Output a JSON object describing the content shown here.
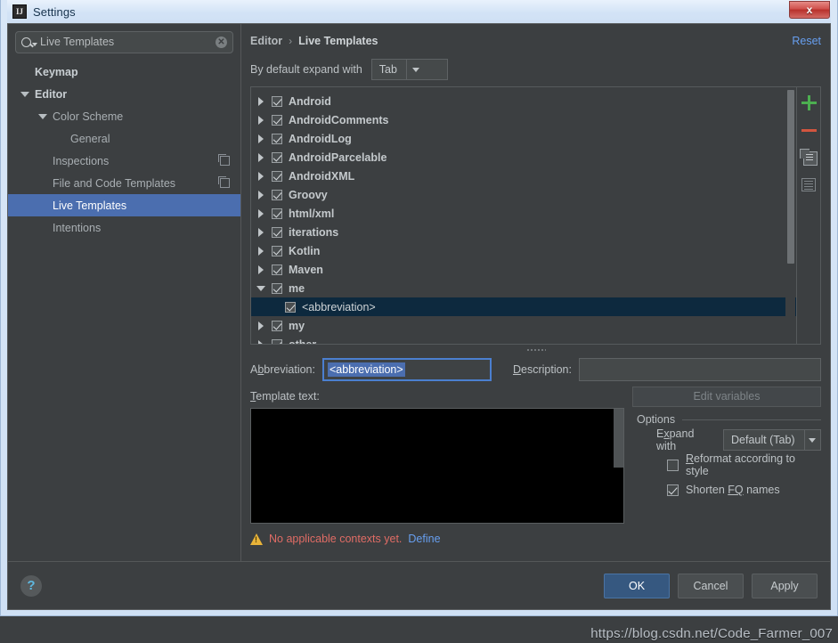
{
  "window": {
    "title": "Settings",
    "app_icon": "IJ",
    "close_label": "x"
  },
  "watermark": "https://blog.csdn.net/Code_Farmer_007",
  "search": {
    "value": "Live Templates",
    "icon": "search-icon",
    "clear_icon": "clear-icon",
    "clear_label": "✕"
  },
  "sidebar": {
    "items": [
      {
        "label": "Keymap",
        "indent": 0,
        "arrow": "none",
        "bold": true,
        "selected": false,
        "badge": false
      },
      {
        "label": "Editor",
        "indent": 0,
        "arrow": "expanded",
        "bold": true,
        "selected": false,
        "badge": false
      },
      {
        "label": "Color Scheme",
        "indent": 1,
        "arrow": "expanded",
        "bold": false,
        "selected": false,
        "badge": false
      },
      {
        "label": "General",
        "indent": 2,
        "arrow": "none",
        "bold": false,
        "selected": false,
        "badge": false
      },
      {
        "label": "Inspections",
        "indent": 1,
        "arrow": "none",
        "bold": false,
        "selected": false,
        "badge": true
      },
      {
        "label": "File and Code Templates",
        "indent": 1,
        "arrow": "none",
        "bold": false,
        "selected": false,
        "badge": true
      },
      {
        "label": "Live Templates",
        "indent": 1,
        "arrow": "none",
        "bold": false,
        "selected": true,
        "badge": false
      },
      {
        "label": "Intentions",
        "indent": 1,
        "arrow": "none",
        "bold": false,
        "selected": false,
        "badge": false
      }
    ]
  },
  "content": {
    "breadcrumb": {
      "parent": "Editor",
      "separator": "›",
      "current": "Live Templates"
    },
    "reset_label": "Reset",
    "expand_row": {
      "label": "By default expand with",
      "value": "Tab"
    }
  },
  "templates_tree": {
    "rows": [
      {
        "label": "Android",
        "arrow": "collapsed",
        "checked": true,
        "child": false,
        "selected": false
      },
      {
        "label": "AndroidComments",
        "arrow": "collapsed",
        "checked": true,
        "child": false,
        "selected": false
      },
      {
        "label": "AndroidLog",
        "arrow": "collapsed",
        "checked": true,
        "child": false,
        "selected": false
      },
      {
        "label": "AndroidParcelable",
        "arrow": "collapsed",
        "checked": true,
        "child": false,
        "selected": false
      },
      {
        "label": "AndroidXML",
        "arrow": "collapsed",
        "checked": true,
        "child": false,
        "selected": false
      },
      {
        "label": "Groovy",
        "arrow": "collapsed",
        "checked": true,
        "child": false,
        "selected": false
      },
      {
        "label": "html/xml",
        "arrow": "collapsed",
        "checked": true,
        "child": false,
        "selected": false
      },
      {
        "label": "iterations",
        "arrow": "collapsed",
        "checked": true,
        "child": false,
        "selected": false
      },
      {
        "label": "Kotlin",
        "arrow": "collapsed",
        "checked": true,
        "child": false,
        "selected": false
      },
      {
        "label": "Maven",
        "arrow": "collapsed",
        "checked": true,
        "child": false,
        "selected": false
      },
      {
        "label": "me",
        "arrow": "expanded",
        "checked": true,
        "child": false,
        "selected": false
      },
      {
        "label": "<abbreviation>",
        "arrow": "none",
        "checked": true,
        "child": true,
        "selected": true
      },
      {
        "label": "my",
        "arrow": "collapsed",
        "checked": true,
        "child": false,
        "selected": false
      },
      {
        "label": "other",
        "arrow": "collapsed",
        "checked": true,
        "child": false,
        "selected": false
      }
    ],
    "buttons": [
      {
        "name": "add-template-button",
        "icon": "plus-icon",
        "color": "#4caf50"
      },
      {
        "name": "remove-template-button",
        "icon": "minus-icon",
        "color": "#d2553f"
      },
      {
        "name": "duplicate-template-button",
        "icon": "copy-icon",
        "color": "#9aa0a4"
      },
      {
        "name": "template-group-button",
        "icon": "lines-icon",
        "color": "#7e8488"
      }
    ]
  },
  "form": {
    "abbreviation_label_pre": "A",
    "abbreviation_label_mn": "b",
    "abbreviation_label_post": "breviation:",
    "abbreviation_value": "<abbreviation>",
    "description_label_mn": "D",
    "description_label_post": "escription:",
    "description_value": "",
    "template_text_label_mn": "T",
    "template_text_label_post": "emplate text:",
    "template_text_value": "",
    "edit_variables_label": "Edit variables"
  },
  "options": {
    "title": "Options",
    "expand_with_label_pre": "E",
    "expand_with_label_mn": "x",
    "expand_with_label_post": "pand with",
    "expand_with_value": "Default (Tab)",
    "reformat": {
      "label_mn": "R",
      "label_post": "eformat according to style",
      "checked": false
    },
    "shorten": {
      "label_pre": "Shorten ",
      "label_mn": "FQ",
      "label_post": " names",
      "checked": true
    }
  },
  "warning": {
    "icon": "warning-icon",
    "text": "No applicable contexts yet.",
    "link": "Define"
  },
  "footer": {
    "help_label": "?",
    "ok_label": "OK",
    "cancel_label": "Cancel",
    "apply_label": "Apply"
  },
  "colors": {
    "accent_blue": "#4b6eaf",
    "link_blue": "#679ff0",
    "selection_dark": "#0d293e",
    "warning_red": "#e06c65",
    "warning_yellow": "#e8b339",
    "panel_bg": "#3c3f41"
  }
}
